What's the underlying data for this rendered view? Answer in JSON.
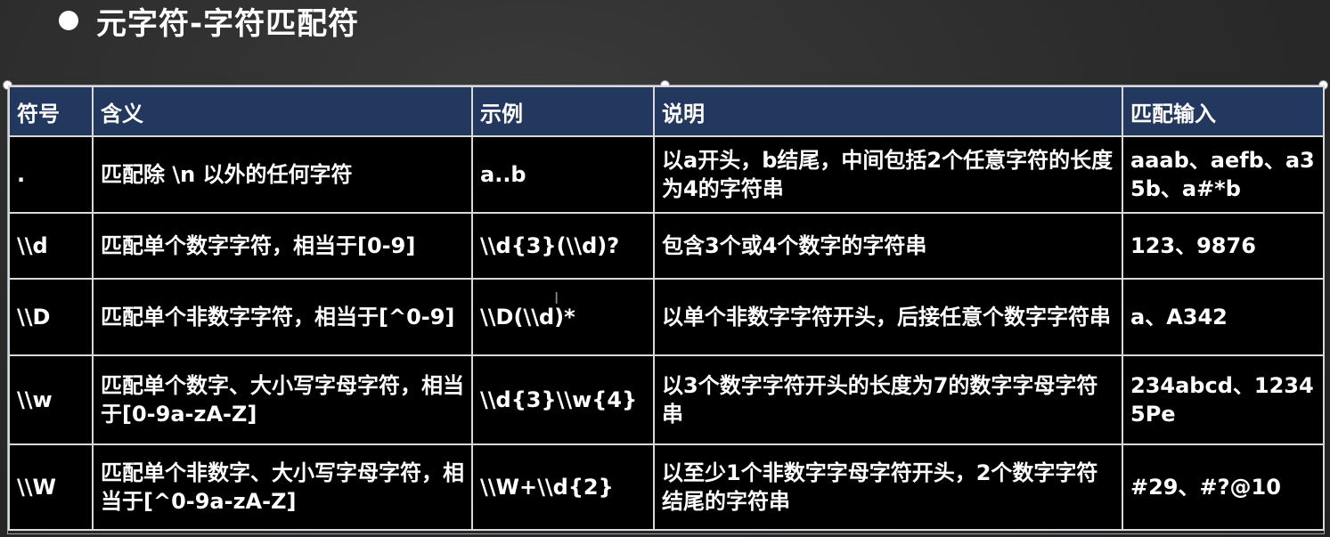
{
  "title": "元字符-字符匹配符",
  "table": {
    "headers": [
      "符号",
      "含义",
      "示例",
      "说明",
      "匹配输入"
    ],
    "rows": [
      {
        "symbol": ".",
        "meaning": "匹配除 \\n 以外的任何字符",
        "example": "a..b",
        "description": "以a开头，b结尾，中间包括2个任意字符的长度为4的字符串",
        "matches": "aaab、aefb、a35b、a#*b"
      },
      {
        "symbol": "\\\\d",
        "meaning": "匹配单个数字字符，相当于[0-9]",
        "example": "\\\\d{3}(\\\\d)?",
        "description": "包含3个或4个数字的字符串",
        "matches": "123、9876"
      },
      {
        "symbol": "\\\\D",
        "meaning": "匹配单个非数字字符，相当于[^0-9]",
        "example": "\\\\D(\\\\d)*",
        "description": "以单个非数字字符开头，后接任意个数字字符串",
        "matches": "a、A342"
      },
      {
        "symbol": "\\\\w",
        "meaning": "匹配单个数字、大小写字母字符，相当于[0-9a-zA-Z]",
        "example": "\\\\d{3}\\\\w{4}",
        "description": "以3个数字字符开头的长度为7的数字字母字符串",
        "matches": "234abcd、12345Pe"
      },
      {
        "symbol": "\\\\W",
        "meaning": "匹配单个非数字、大小写字母字符，相当于[^0-9a-zA-Z]",
        "example": "\\\\W+\\\\d{2}",
        "description": "以至少1个非数字字母字符开头，2个数字字符结尾的字符串",
        "matches": "#29、#?@10"
      }
    ]
  },
  "colors": {
    "header_bg": "#23385f",
    "cell_bg": "#000000",
    "text": "#ffffff",
    "page_bg": "#2b2b2b"
  }
}
